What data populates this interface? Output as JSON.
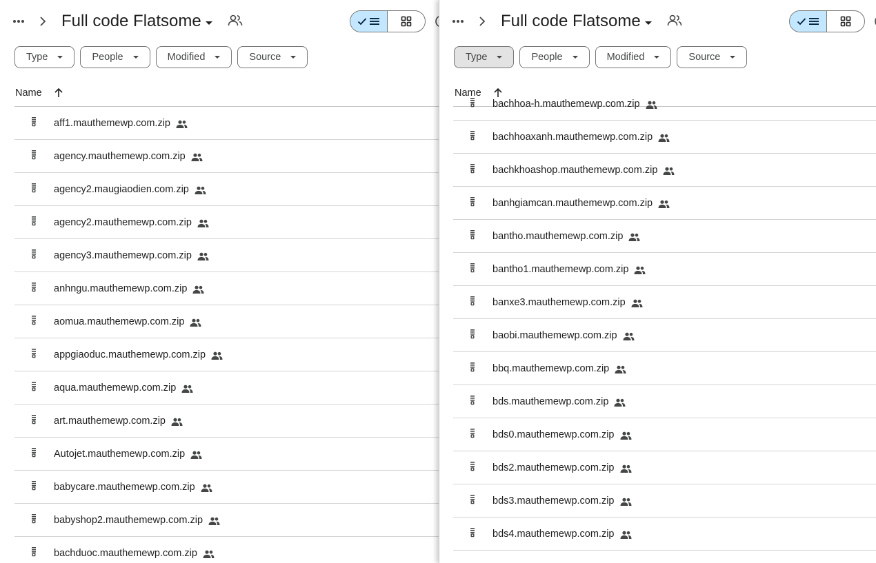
{
  "left": {
    "title": "Full code Flatsome",
    "filters": [
      "Type",
      "People",
      "Modified",
      "Source"
    ],
    "column_name": "Name",
    "files": [
      "aff1.mauthemewp.com.zip",
      "agency.mauthemewp.com.zip",
      "agency2.maugiaodien.com.zip",
      "agency2.mauthemewp.com.zip",
      "agency3.mauthemewp.com.zip",
      "anhngu.mauthemewp.com.zip",
      "aomua.mauthemewp.com.zip",
      "appgiaoduc.mauthemewp.com.zip",
      "aqua.mauthemewp.com.zip",
      "art.mauthemewp.com.zip",
      "Autojet.mauthemewp.com.zip",
      "babycare.mauthemewp.com.zip",
      "babyshop2.mauthemewp.com.zip",
      "bachduoc.mauthemewp.com.zip"
    ]
  },
  "right": {
    "title": "Full code Flatsome",
    "filters": [
      "Type",
      "People",
      "Modified",
      "Source"
    ],
    "column_name": "Name",
    "files": [
      "bachhoa-h.mauthemewp.com.zip",
      "bachhoaxanh.mauthemewp.com.zip",
      "bachkhoashop.mauthemewp.com.zip",
      "banhgiamcan.mauthemewp.com.zip",
      "bantho.mauthemewp.com.zip",
      "bantho1.mauthemewp.com.zip",
      "banxe3.mauthemewp.com.zip",
      "baobi.mauthemewp.com.zip",
      "bbq.mauthemewp.com.zip",
      "bds.mauthemewp.com.zip",
      "bds0.mauthemewp.com.zip",
      "bds2.mauthemewp.com.zip",
      "bds3.mauthemewp.com.zip",
      "bds4.mauthemewp.com.zip"
    ]
  },
  "icons": {
    "more": "more-horiz-icon",
    "breadcrumb": "chevron-right-icon",
    "share": "shared-folder-icon",
    "list_view": "list-view-icon",
    "grid_view": "grid-view-icon",
    "sort": "arrow-up-icon",
    "file": "zip-file-icon",
    "shared": "people-icon"
  },
  "colors": {
    "accent_toggle": "#c2e7ff",
    "text": "#1f1f1f",
    "border": "#747775"
  }
}
